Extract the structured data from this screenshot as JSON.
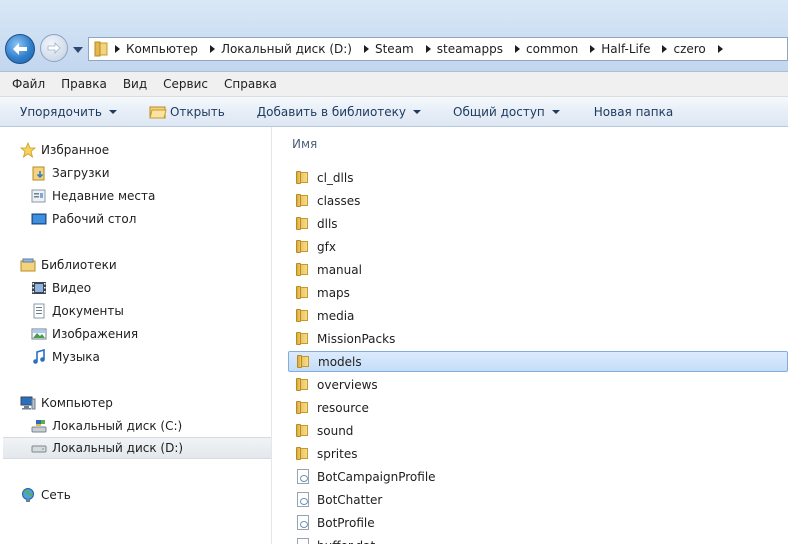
{
  "address_bar": {
    "breadcrumbs": [
      "Компьютер",
      "Локальный диск (D:)",
      "Steam",
      "steamapps",
      "common",
      "Half-Life",
      "czero"
    ]
  },
  "menu": {
    "items": [
      "Файл",
      "Правка",
      "Вид",
      "Сервис",
      "Справка"
    ]
  },
  "toolbar": {
    "organize": "Упорядочить",
    "open": "Открыть",
    "add_to_library": "Добавить в библиотеку",
    "share": "Общий доступ",
    "new_folder": "Новая папка"
  },
  "nav": {
    "favorites": {
      "label": "Избранное",
      "icon": "star-icon",
      "items": [
        {
          "label": "Загрузки",
          "icon": "downloads-icon"
        },
        {
          "label": "Недавние места",
          "icon": "recent-places-icon"
        },
        {
          "label": "Рабочий стол",
          "icon": "desktop-icon"
        }
      ]
    },
    "libraries": {
      "label": "Библиотеки",
      "icon": "library-icon",
      "items": [
        {
          "label": "Видео",
          "icon": "video-icon"
        },
        {
          "label": "Документы",
          "icon": "documents-icon"
        },
        {
          "label": "Изображения",
          "icon": "pictures-icon"
        },
        {
          "label": "Музыка",
          "icon": "music-icon"
        }
      ]
    },
    "computer": {
      "label": "Компьютер",
      "icon": "computer-icon",
      "items": [
        {
          "label": "Локальный диск (C:)",
          "icon": "drive-icon"
        },
        {
          "label": "Локальный диск (D:)",
          "icon": "drive-icon",
          "selected": true
        }
      ]
    },
    "network": {
      "label": "Сеть",
      "icon": "network-icon"
    }
  },
  "content": {
    "column_header": "Имя",
    "files": [
      {
        "name": "cl_dlls",
        "type": "folder"
      },
      {
        "name": "classes",
        "type": "folder"
      },
      {
        "name": "dlls",
        "type": "folder"
      },
      {
        "name": "gfx",
        "type": "folder"
      },
      {
        "name": "manual",
        "type": "folder"
      },
      {
        "name": "maps",
        "type": "folder"
      },
      {
        "name": "media",
        "type": "folder"
      },
      {
        "name": "MissionPacks",
        "type": "folder"
      },
      {
        "name": "models",
        "type": "folder",
        "selected": true
      },
      {
        "name": "overviews",
        "type": "folder"
      },
      {
        "name": "resource",
        "type": "folder"
      },
      {
        "name": "sound",
        "type": "folder"
      },
      {
        "name": "sprites",
        "type": "folder"
      },
      {
        "name": "BotCampaignProfile",
        "type": "file"
      },
      {
        "name": "BotChatter",
        "type": "file"
      },
      {
        "name": "BotProfile",
        "type": "file"
      },
      {
        "name": "buffer.dat",
        "type": "file"
      }
    ]
  },
  "colors": {
    "selection_bg": "#cce2f9",
    "selection_border": "#84acdd",
    "titlebar": "#cfe0f3",
    "command_bar": "#e7eef7"
  }
}
